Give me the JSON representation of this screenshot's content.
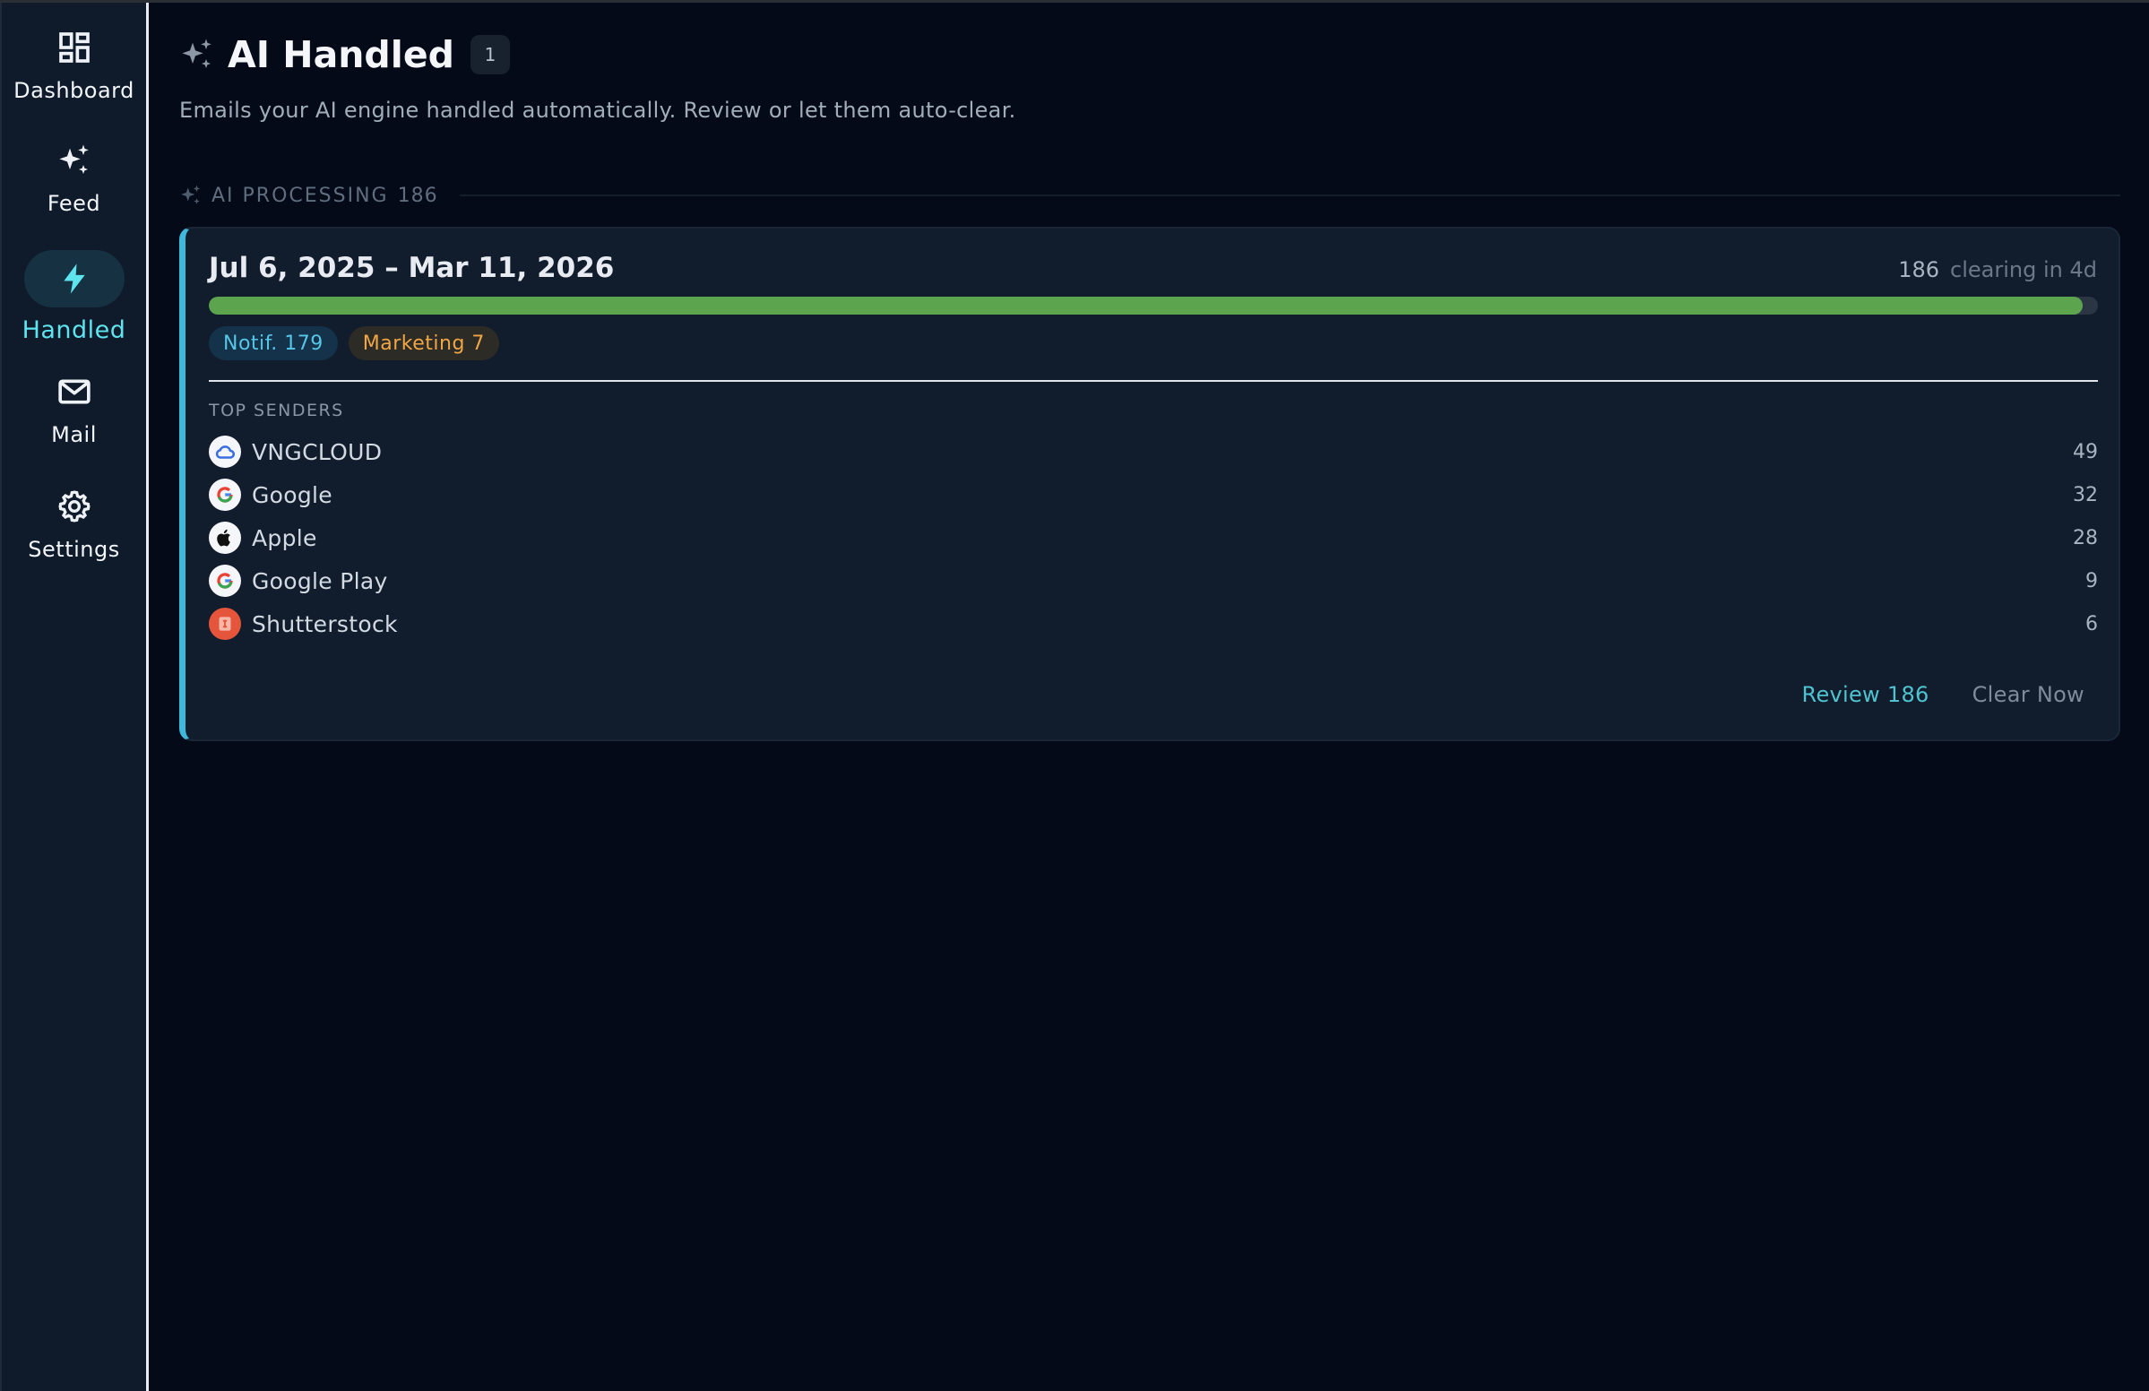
{
  "sidebar": {
    "items": [
      {
        "label": "Dashboard",
        "icon": "dashboard-icon",
        "active": false
      },
      {
        "label": "Feed",
        "icon": "sparkles-icon",
        "active": false
      },
      {
        "label": "Handled",
        "icon": "lightning-icon",
        "active": true
      },
      {
        "label": "Mail",
        "icon": "mail-icon",
        "active": false
      },
      {
        "label": "Settings",
        "icon": "gear-icon",
        "active": false
      }
    ]
  },
  "header": {
    "title": "AI Handled",
    "count": "1",
    "subtitle": "Emails your AI engine handled automatically. Review or let them auto-clear."
  },
  "section": {
    "label": "AI PROCESSING",
    "count": "186"
  },
  "card": {
    "date_range": "Jul 6, 2025 – Mar 11, 2026",
    "total": "186",
    "clearing": "clearing in 4d",
    "progress": 0.992,
    "tags": {
      "notif": "Notif. 179",
      "marketing": "Marketing 7"
    },
    "senders_title": "TOP SENDERS",
    "senders": [
      {
        "name": "VNGCLOUD",
        "count": "49",
        "icon": "cloud-icon"
      },
      {
        "name": "Google",
        "count": "32",
        "icon": "google-icon"
      },
      {
        "name": "Apple",
        "count": "28",
        "icon": "apple-icon"
      },
      {
        "name": "Google Play",
        "count": "9",
        "icon": "google-icon"
      },
      {
        "name": "Shutterstock",
        "count": "6",
        "icon": "shutterstock-icon"
      }
    ],
    "review_label": "Review 186",
    "clear_label": "Clear Now"
  },
  "colors": {
    "accent": "#5ee4ef",
    "progress": "#5ca44d",
    "card_border": "#3fb8dc",
    "notif": "#57c6e6",
    "marketing": "#f0a646"
  }
}
